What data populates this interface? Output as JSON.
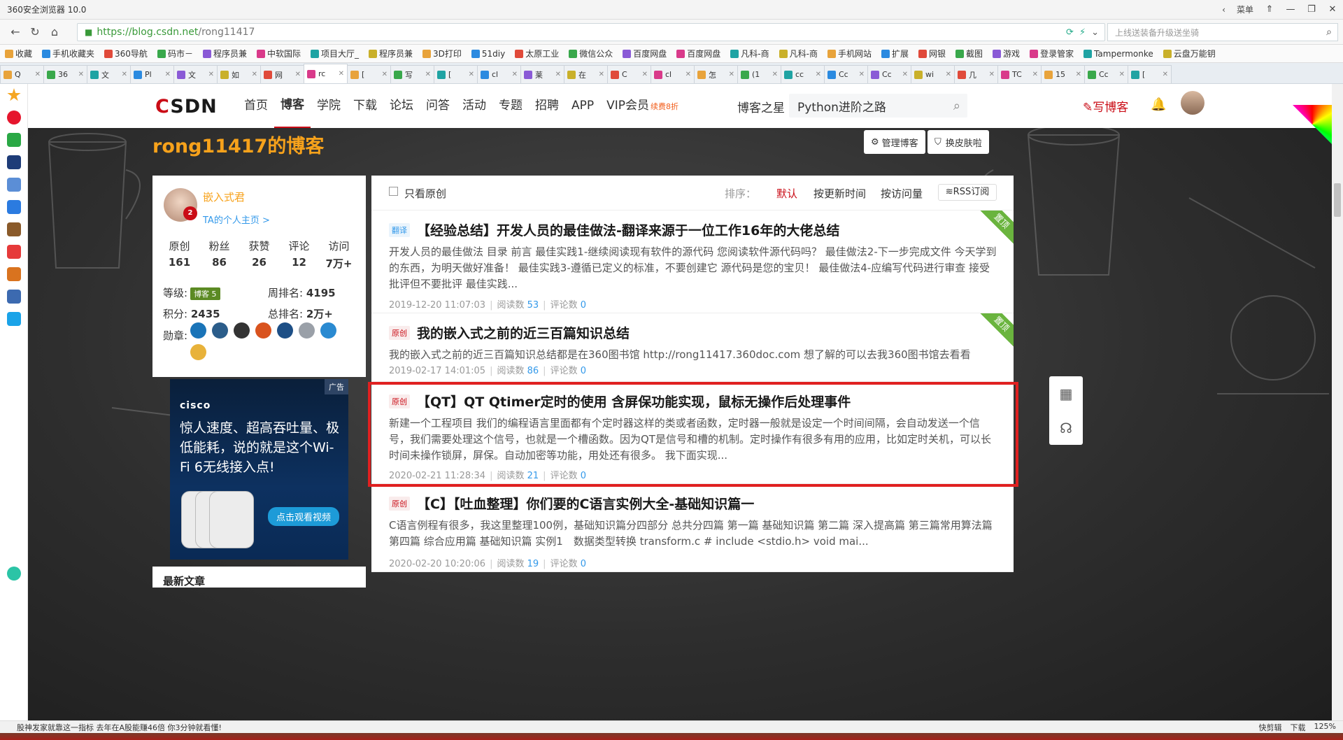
{
  "browser": {
    "title": "360安全浏览器 10.0",
    "menu_label": "菜单",
    "url_host": "https://blog.csdn.net",
    "url_path": "/rong11417",
    "search_placeholder": "上线送装备升级送坐骑",
    "bookmarks": [
      "收藏",
      "手机收藏夹",
      "360导航",
      "码市－",
      "程序员兼",
      "中软国际",
      "项目大厅_",
      "程序员兼",
      "3D打印",
      "51diy",
      "太原工业",
      "微信公众",
      "百度网盘",
      "百度网盘",
      "凡科-商",
      "凡科-商",
      "手机网站",
      "扩展",
      "网银",
      "截图",
      "游戏",
      "登录管家",
      "Tampermonke",
      "云盘万能钥"
    ],
    "tabs": [
      "Q",
      "36",
      "文",
      "Pl",
      "文",
      "如",
      "网",
      "rc",
      "[",
      "写",
      "[",
      "cl",
      "莱",
      "在",
      "C",
      "cl",
      "怎",
      "(1",
      "cc",
      "Cc",
      "Cc",
      "wi",
      "几",
      "TC",
      "15",
      "Cc",
      "["
    ],
    "status_left": "股神发家就靠这一指标 去年在A股能赚46倍 你3分钟就看懂!",
    "status_right": [
      "快剪辑",
      "下载",
      "125%"
    ]
  },
  "csdn": {
    "logo": "CSDN",
    "nav": [
      "首页",
      "博客",
      "学院",
      "下载",
      "论坛",
      "问答",
      "活动",
      "专题",
      "招聘",
      "APP",
      "VIP会员"
    ],
    "vip_tag": "续费8折",
    "blog_star": "博客之星",
    "search_value": "Python进阶之路",
    "write_label": "写博客"
  },
  "blog": {
    "title": "rong11417的博客",
    "manage_label": "管理博客",
    "skin_label": "换皮肤啦"
  },
  "profile": {
    "name": "嵌入式君",
    "badge": "2",
    "home_link": "TA的个人主页 >",
    "stats": [
      {
        "k": "原创",
        "v": "161"
      },
      {
        "k": "粉丝",
        "v": "86"
      },
      {
        "k": "获赞",
        "v": "26"
      },
      {
        "k": "评论",
        "v": "12"
      },
      {
        "k": "访问",
        "v": "7万+"
      }
    ],
    "level_label": "等级:",
    "level_value": "博客 5",
    "week_rank_label": "周排名:",
    "week_rank": "4195",
    "points_label": "积分:",
    "points": "2435",
    "total_rank_label": "总排名:",
    "total_rank": "2万+",
    "medals_label": "勋章:"
  },
  "ad": {
    "tag": "广告",
    "brand": "cisco",
    "text": "惊人速度、超高吞吐量、极低能耗，说的就是这个Wi-Fi 6无线接入点!",
    "button": "点击观看视频"
  },
  "newest_title": "最新文章",
  "filter": {
    "only_original": "只看原创",
    "sort_label": "排序：",
    "sort_options": [
      "默认",
      "按更新时间",
      "按访问量"
    ],
    "rss": "RSS订阅"
  },
  "articles": [
    {
      "tag": "翻译",
      "title": "【经验总结】开发人员的最佳做法-翻译来源于一位工作16年的大佬总结",
      "desc": "开发人员的最佳做法 目录 前言 最佳实践1-继续阅读现有软件的源代码 您阅读软件源代码吗？ 最佳做法2-下一步完成文件 今天学到的东西，为明天做好准备！ 最佳实践3-遵循已定义的标准，不要创建它 源代码是您的宝贝！ 最佳做法4-应编写代码进行审查 接受批评但不要批评 最佳实践...",
      "date": "2019-12-20 11:07:03",
      "reads_label": "阅读数",
      "reads": "53",
      "comments_label": "评论数",
      "comments": "0",
      "pinned": "置顶"
    },
    {
      "tag": "原创",
      "title": "我的嵌入式之前的近三百篇知识总结",
      "desc": "我的嵌入式之前的近三百篇知识总结都是在360图书馆 http://rong11417.360doc.com 想了解的可以去我360图书馆去看看",
      "date": "2019-02-17 14:01:05",
      "reads_label": "阅读数",
      "reads": "86",
      "comments_label": "评论数",
      "comments": "0",
      "pinned": "置顶"
    },
    {
      "tag": "原创",
      "title": "【QT】QT Qtimer定时的使用 含屏保功能实现，鼠标无操作后处理事件",
      "desc": "新建一个工程项目 我们的编程语言里面都有个定时器这样的类或者函数，定时器一般就是设定一个时间间隔，会自动发送一个信号，我们需要处理这个信号，也就是一个槽函数。因为QT是信号和槽的机制。定时操作有很多有用的应用，比如定时关机，可以长时间未操作锁屏，屏保。自动加密等功能，用处还有很多。 我下面实现...",
      "date": "2020-02-21 11:28:34",
      "reads_label": "阅读数",
      "reads": "21",
      "comments_label": "评论数",
      "comments": "0",
      "pinned": ""
    },
    {
      "tag": "原创",
      "title": "【C】【吐血整理】你们要的C语言实例大全-基础知识篇一",
      "desc": "C语言例程有很多，我这里整理100例，基础知识篇分四部分 总共分四篇 第一篇 基础知识篇 第二篇 深入提高篇 第三篇常用算法篇 第四篇 综合应用篇 基础知识篇 实例1　数据类型转换 transform.c # include <stdio.h> void mai...",
      "date": "2020-02-20 10:20:06",
      "reads_label": "阅读数",
      "reads": "19",
      "comments_label": "评论数",
      "comments": "0",
      "pinned": ""
    }
  ],
  "colors": {
    "brand": "#ca0c16",
    "orange": "#f7a21b",
    "link": "#3399ea",
    "pin": "#6ab43e",
    "highlight": "#e02020"
  }
}
